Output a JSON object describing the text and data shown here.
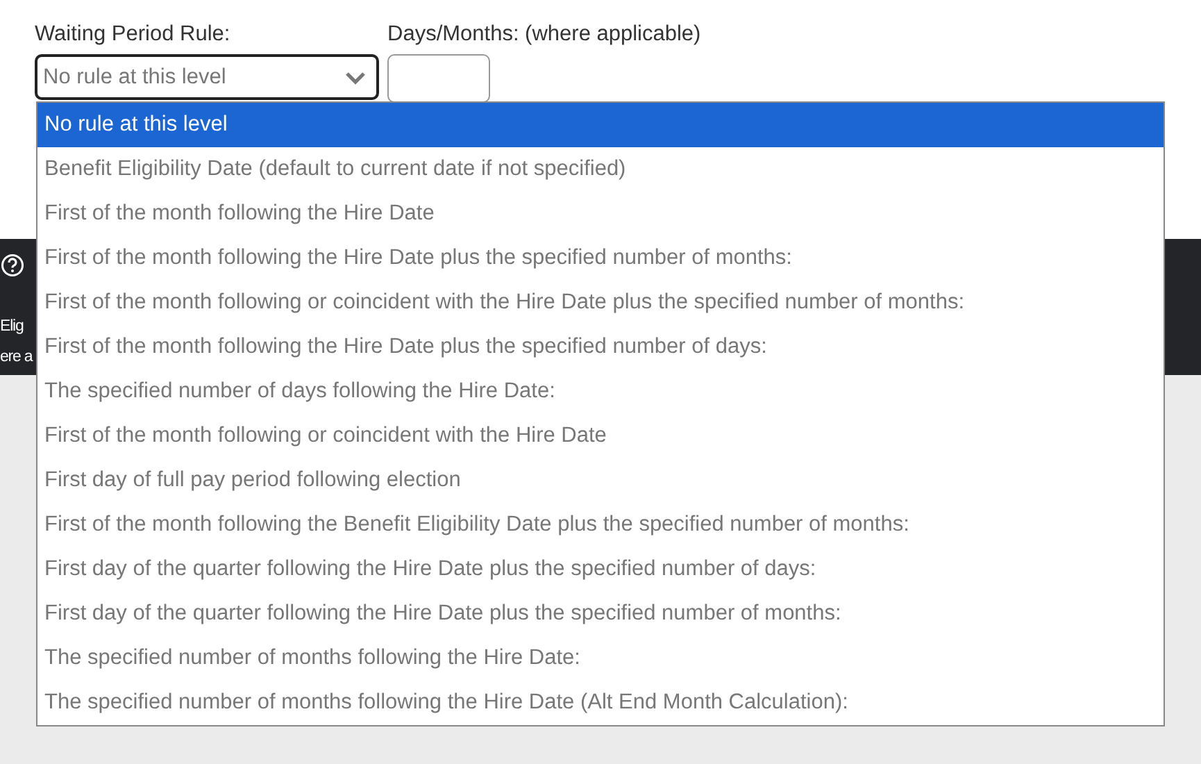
{
  "rule_label": "Waiting Period Rule:",
  "days_label": "Days/Months: (where applicable)",
  "rule_select": {
    "value": "No rule at this level",
    "expanded": true
  },
  "info_bar": {
    "texts": [
      "Elig",
      "ere a"
    ]
  },
  "options": [
    {
      "label": "No rule at this level",
      "selected": true
    },
    {
      "label": "Benefit Eligibility Date (default to current date if not specified)",
      "selected": false
    },
    {
      "label": "First of the month following the Hire Date",
      "selected": false
    },
    {
      "label": "First of the month following the Hire Date plus the specified number of months:",
      "selected": false
    },
    {
      "label": "First of the month following or coincident with the Hire Date plus the specified number of months:",
      "selected": false
    },
    {
      "label": "First of the month following the Hire Date plus the specified number of days:",
      "selected": false
    },
    {
      "label": "The specified number of days following the Hire Date:",
      "selected": false
    },
    {
      "label": "First of the month following or coincident with the Hire Date",
      "selected": false
    },
    {
      "label": "First day of full pay period following election",
      "selected": false
    },
    {
      "label": "First of the month following the Benefit Eligibility Date plus the specified number of months:",
      "selected": false
    },
    {
      "label": "First day of the quarter following the Hire Date plus the specified number of days:",
      "selected": false
    },
    {
      "label": "First day of the quarter following the Hire Date plus the specified number of months:",
      "selected": false
    },
    {
      "label": "The specified number of months following the Hire Date:",
      "selected": false
    },
    {
      "label": "The specified number of months following the Hire Date (Alt End Month Calculation):",
      "selected": false
    }
  ]
}
